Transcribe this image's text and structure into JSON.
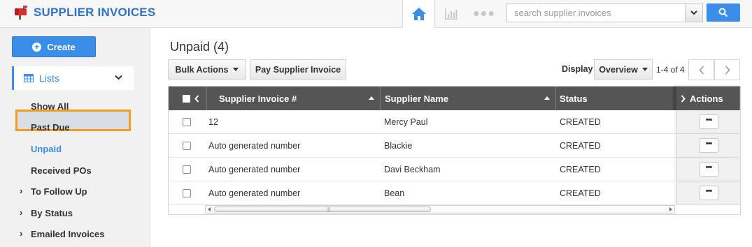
{
  "app": {
    "title": "SUPPLIER INVOICES",
    "brand_color": "#2f73c9",
    "accent_color": "#3b8ee8",
    "icon": "mailbox-flag-icon"
  },
  "topnav": {
    "home_icon": "home-icon",
    "reports_icon": "bar-chart-icon",
    "more_icon": "ellipsis-icon"
  },
  "search": {
    "placeholder": "search supplier invoices",
    "value": ""
  },
  "sidebar": {
    "create_label": "Create",
    "lists_label": "Lists",
    "items": [
      {
        "label": "Show All"
      },
      {
        "label": "Past Due"
      },
      {
        "label": "Unpaid",
        "active": true
      },
      {
        "label": "Received POs"
      }
    ],
    "groups": [
      {
        "label": "To Follow Up"
      },
      {
        "label": "By Status"
      },
      {
        "label": "Emailed Invoices"
      }
    ]
  },
  "main": {
    "title": "Unpaid (4)",
    "bulk_actions_label": "Bulk Actions",
    "pay_label": "Pay Supplier Invoice",
    "display_label": "Display",
    "display_value": "Overview",
    "page_count": "1-4 of 4"
  },
  "table": {
    "columns": [
      "Supplier Invoice #",
      "Supplier Name",
      "Status",
      "Actions"
    ],
    "rows": [
      {
        "invoice": "12",
        "supplier": "Mercy Paul",
        "status": "CREATED",
        "action": "•••"
      },
      {
        "invoice": "Auto generated number",
        "supplier": "Blackie",
        "status": "CREATED",
        "action": "•••"
      },
      {
        "invoice": "Auto generated number",
        "supplier": "Davi Beckham",
        "status": "CREATED",
        "action": "•••"
      },
      {
        "invoice": "Auto generated number",
        "supplier": "Bean",
        "status": "CREATED",
        "action": "•••"
      }
    ]
  }
}
